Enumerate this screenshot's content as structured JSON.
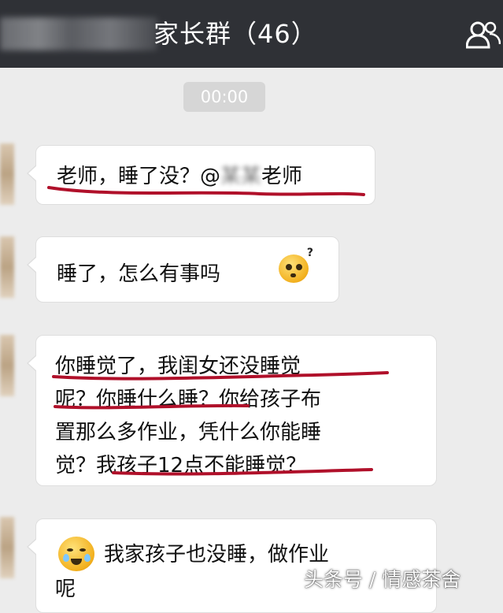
{
  "header": {
    "title_visible": "家长群（46）"
  },
  "timestamp": "00:00",
  "messages": [
    {
      "text_before": "老师，睡了没？@",
      "text_after": "老师"
    },
    {
      "text": "睡了，怎么有事吗",
      "emoji": "confused-face-emoji"
    },
    {
      "lines": [
        "你睡觉了，我闺女还没睡觉",
        "呢？你睡什么睡？你给孩子布",
        "置那么多作业，凭什么你能睡",
        "觉？我孩子12点不能睡觉？"
      ]
    },
    {
      "emoji": "crying-face-emoji",
      "lines": [
        "我家孩子也没睡，做作业",
        "呢"
      ]
    }
  ],
  "watermark": "头条号 / 情感茶舍",
  "colors": {
    "header_bg": "#2f3136",
    "chat_bg": "#ececec",
    "bubble_bg": "#ffffff",
    "underline": "#b0102a"
  }
}
